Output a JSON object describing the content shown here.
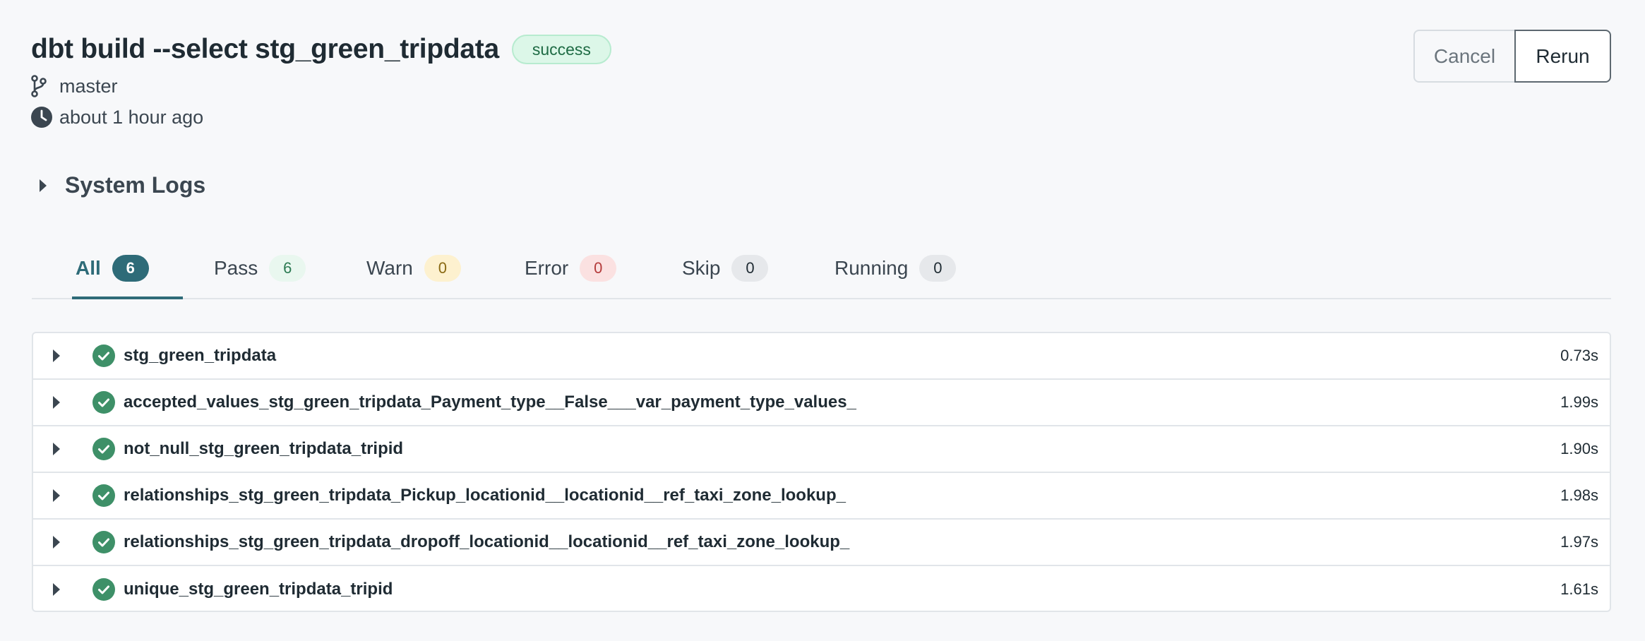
{
  "header": {
    "title": "dbt build --select stg_green_tripdata",
    "status": "success",
    "branch": "master",
    "time_ago": "about 1 hour ago"
  },
  "actions": {
    "cancel": "Cancel",
    "rerun": "Rerun"
  },
  "system_logs": {
    "label": "System Logs"
  },
  "tabs": [
    {
      "label": "All",
      "count": "6"
    },
    {
      "label": "Pass",
      "count": "6"
    },
    {
      "label": "Warn",
      "count": "0"
    },
    {
      "label": "Error",
      "count": "0"
    },
    {
      "label": "Skip",
      "count": "0"
    },
    {
      "label": "Running",
      "count": "0"
    }
  ],
  "results": [
    {
      "name": "stg_green_tripdata",
      "duration": "0.73s"
    },
    {
      "name": "accepted_values_stg_green_tripdata_Payment_type__False___var_payment_type_values_",
      "duration": "1.99s"
    },
    {
      "name": "not_null_stg_green_tripdata_tripid",
      "duration": "1.90s"
    },
    {
      "name": "relationships_stg_green_tripdata_Pickup_locationid__locationid__ref_taxi_zone_lookup_",
      "duration": "1.98s"
    },
    {
      "name": "relationships_stg_green_tripdata_dropoff_locationid__locationid__ref_taxi_zone_lookup_",
      "duration": "1.97s"
    },
    {
      "name": "unique_stg_green_tripdata_tripid",
      "duration": "1.61s"
    }
  ],
  "colors": {
    "accent": "#2e6b78",
    "success": "#3e9068",
    "success_badge_bg": "#dcf7e8",
    "warn_badge_bg": "#fdf1cf",
    "error_badge_bg": "#fbe1e1",
    "neutral_badge_bg": "#e6e8eb"
  },
  "icons": {
    "branch": "git-branch-icon",
    "clock": "clock-icon",
    "expand": "caret-right-icon",
    "status": "check-circle-icon"
  }
}
